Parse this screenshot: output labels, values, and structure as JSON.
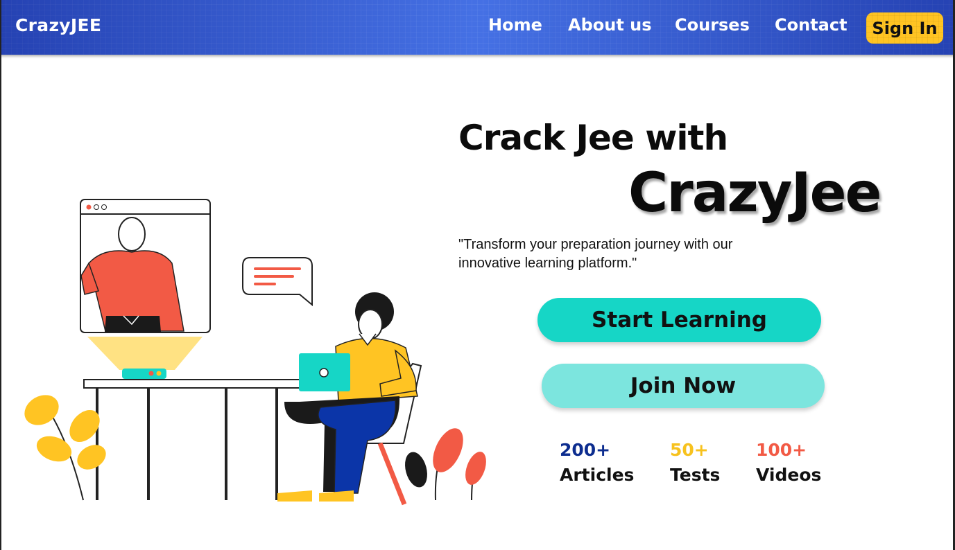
{
  "navbar": {
    "brand": "CrazyJEE",
    "links": [
      {
        "label": "Home"
      },
      {
        "label": "About us"
      },
      {
        "label": "Courses"
      },
      {
        "label": "Contact"
      }
    ],
    "signin_label": "Sign In"
  },
  "hero": {
    "line1": "Crack Jee with",
    "line2": "CrazyJee",
    "tagline": "\"Transform your preparation journey with our innovative learning platform.\""
  },
  "actions": {
    "start_label": "Start Learning",
    "join_label": "Join Now"
  },
  "stats": [
    {
      "value": "200+",
      "label": "Articles",
      "color": "#0d2d8f"
    },
    {
      "value": "50+",
      "label": "Tests",
      "color": "#f7c21e"
    },
    {
      "value": "100+",
      "label": "Videos",
      "color": "#f25a45"
    }
  ],
  "colors": {
    "nav_bg": "#3a62d6",
    "signin_bg": "#ffc423",
    "start_bg": "#16d6c6",
    "join_bg": "#7ce5de",
    "illustration_red": "#f25a45",
    "illustration_yellow": "#ffc423",
    "illustration_teal": "#16d6c6",
    "illustration_blue": "#0b35a8"
  },
  "icons": {
    "window_controls": "window-dots-icon",
    "chat": "chat-bubble-icon"
  }
}
